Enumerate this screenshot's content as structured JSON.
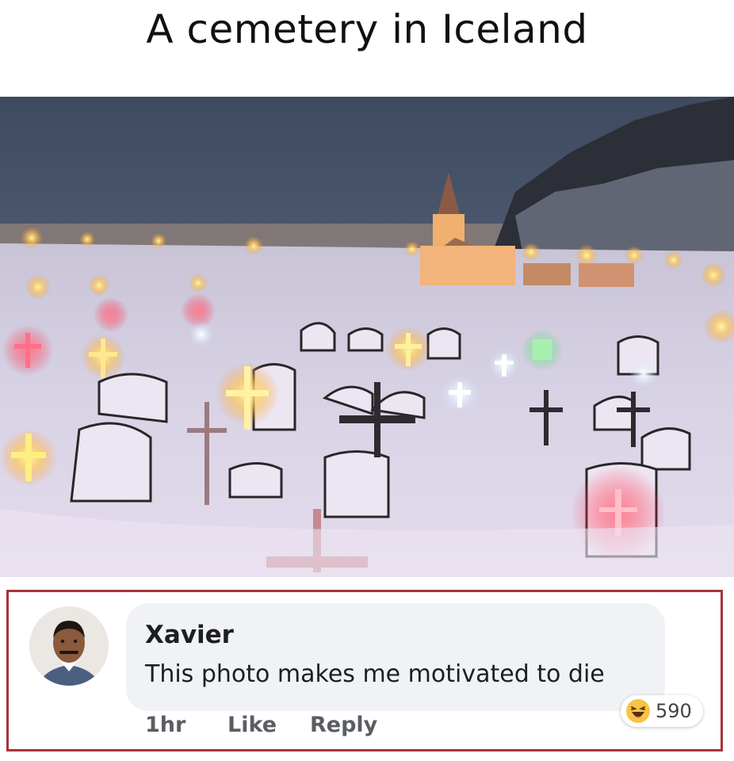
{
  "title": "A cemetery in Iceland",
  "comment": {
    "author": "Xavier",
    "text": "This photo makes me motivated to die",
    "time": "1hr",
    "like_label": "Like",
    "reply_label": "Reply",
    "reaction_icon": "laughing-emoji-icon",
    "reaction_count": "590"
  },
  "colors": {
    "frame": "#a8343a",
    "bubble": "#f0f2f5"
  }
}
